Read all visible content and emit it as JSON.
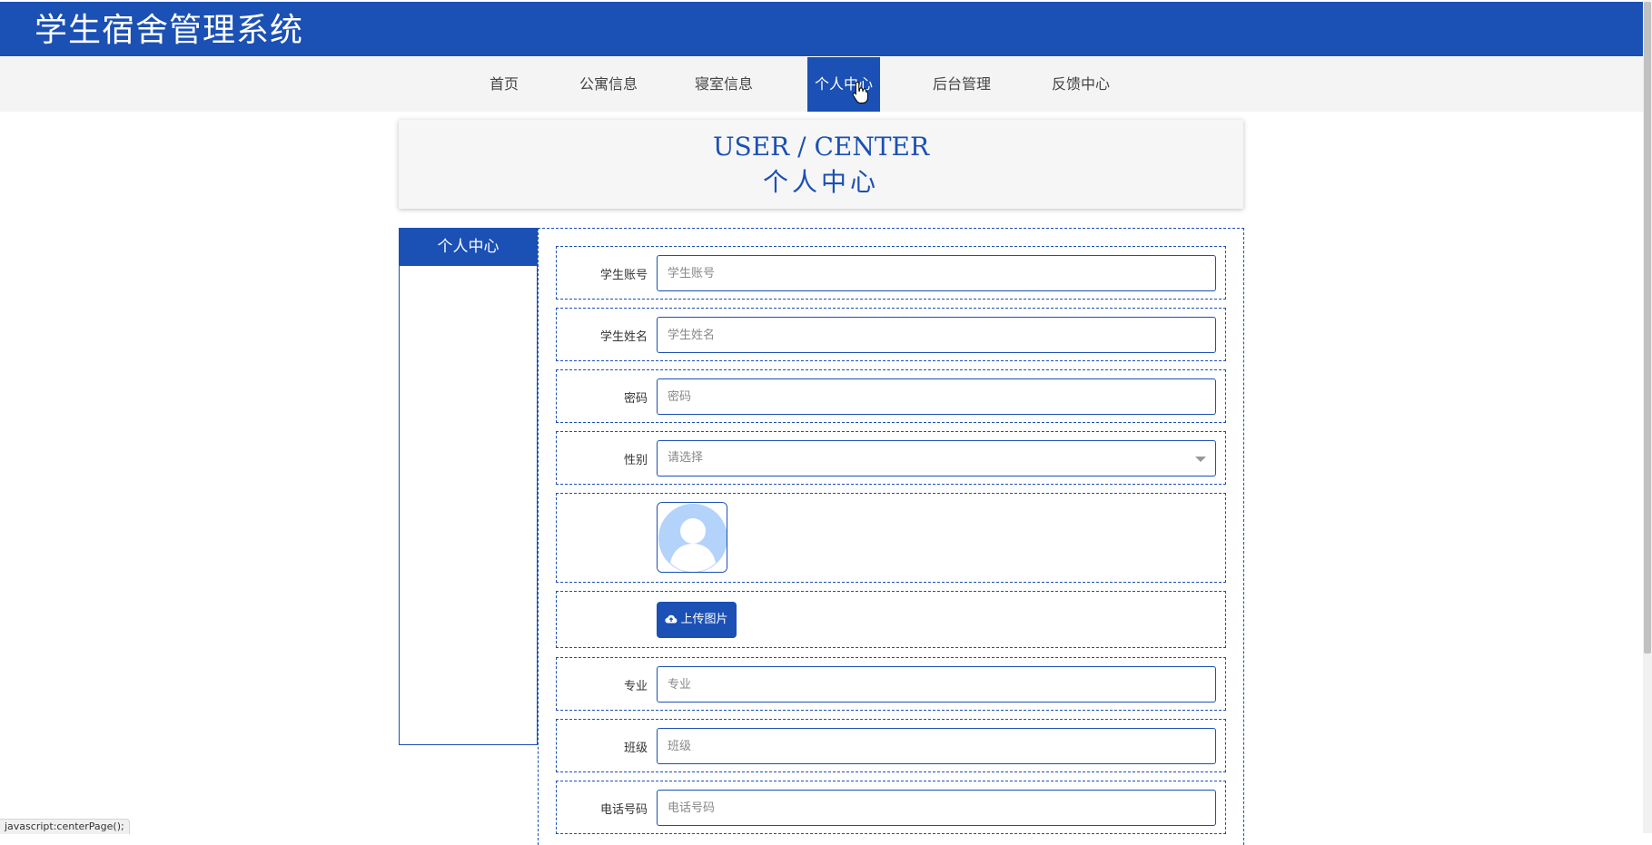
{
  "app": {
    "title": "学生宿舍管理系统"
  },
  "nav": {
    "items": [
      {
        "label": "首页"
      },
      {
        "label": "公寓信息"
      },
      {
        "label": "寝室信息"
      },
      {
        "label": "个人中心",
        "active": true
      },
      {
        "label": "后台管理"
      },
      {
        "label": "反馈中心"
      }
    ]
  },
  "page_title": {
    "en": "USER / CENTER",
    "cn": "个人中心"
  },
  "sidebar": {
    "heading": "个人中心"
  },
  "form": {
    "student_account": {
      "label": "学生账号",
      "placeholder": "学生账号",
      "value": ""
    },
    "student_name": {
      "label": "学生姓名",
      "placeholder": "学生姓名",
      "value": ""
    },
    "password": {
      "label": "密码",
      "placeholder": "密码",
      "value": ""
    },
    "gender": {
      "label": "性别",
      "selected": "请选择"
    },
    "avatar": {
      "icon": "user-avatar-icon"
    },
    "upload": {
      "label": "上传图片",
      "icon": "cloud-upload-icon"
    },
    "major": {
      "label": "专业",
      "placeholder": "专业",
      "value": ""
    },
    "class": {
      "label": "班级",
      "placeholder": "班级",
      "value": ""
    },
    "phone": {
      "label": "电话号码",
      "placeholder": "电话号码",
      "value": ""
    }
  },
  "status_bar": {
    "text": "javascript:centerPage();"
  },
  "colors": {
    "primary": "#1b50b4",
    "nav_bg": "#f4f4f4",
    "avatar_fill": "#b3d3fb"
  }
}
